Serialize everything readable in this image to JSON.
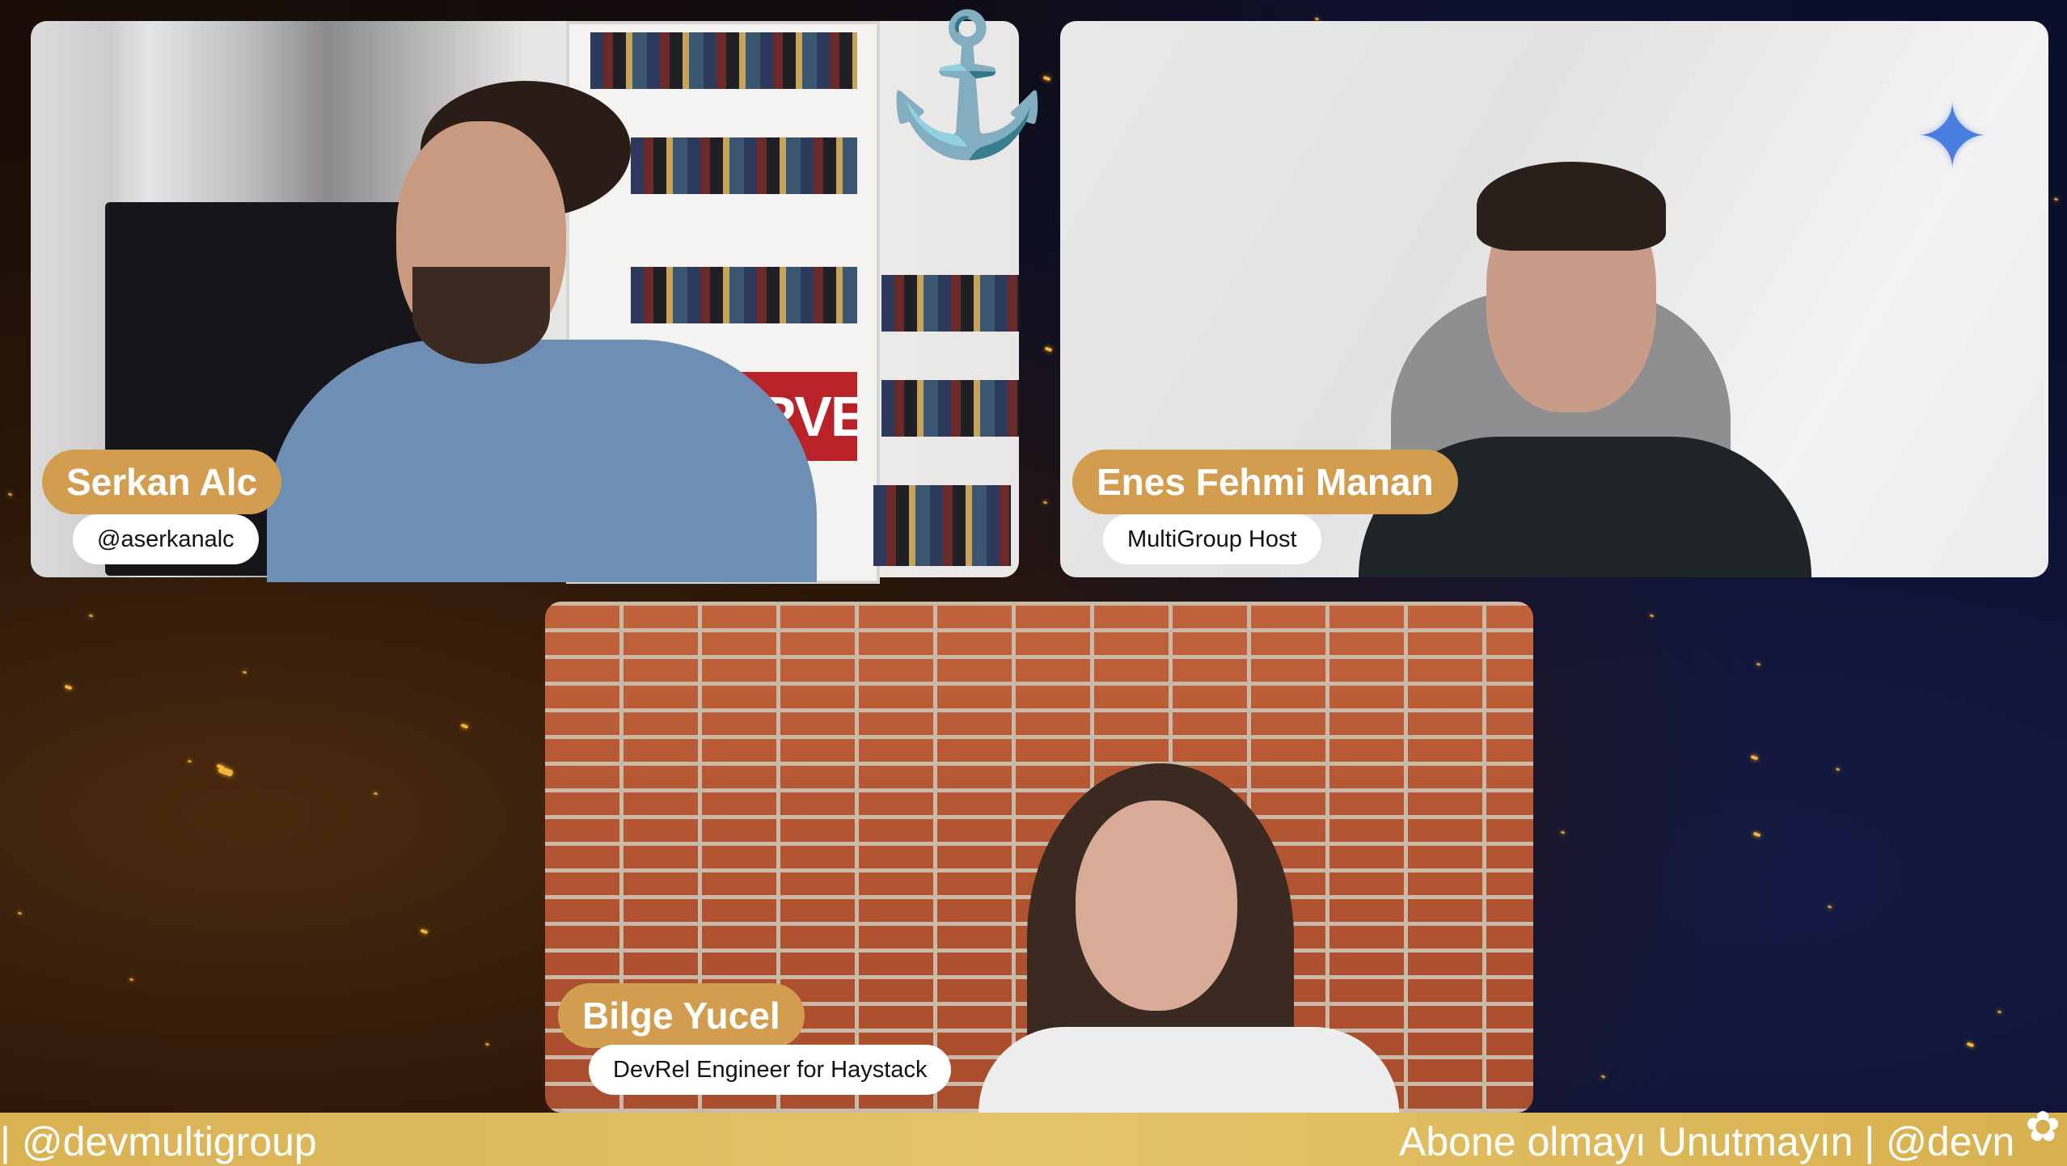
{
  "participants": [
    {
      "name": "Serkan Alc",
      "subtitle": "@aserkanalc"
    },
    {
      "name": "Enes Fehmi Manan",
      "subtitle": "MultiGroup Host"
    },
    {
      "name": "Bilge Yucel",
      "subtitle": "DevRel Engineer for Haystack"
    }
  ],
  "scene": {
    "poster_text": "MARVEL"
  },
  "ticker": {
    "left_text": "| @devmultigroup",
    "right_text": "Abone olmayı Unutmayın | @devn"
  },
  "colors": {
    "name_pill": "#d29d4f",
    "ticker": "#deb95c",
    "accent_sparkle": "#4a7fe0"
  },
  "icons": {
    "sparkle": "four-point-star",
    "corner": "gear-icon"
  }
}
